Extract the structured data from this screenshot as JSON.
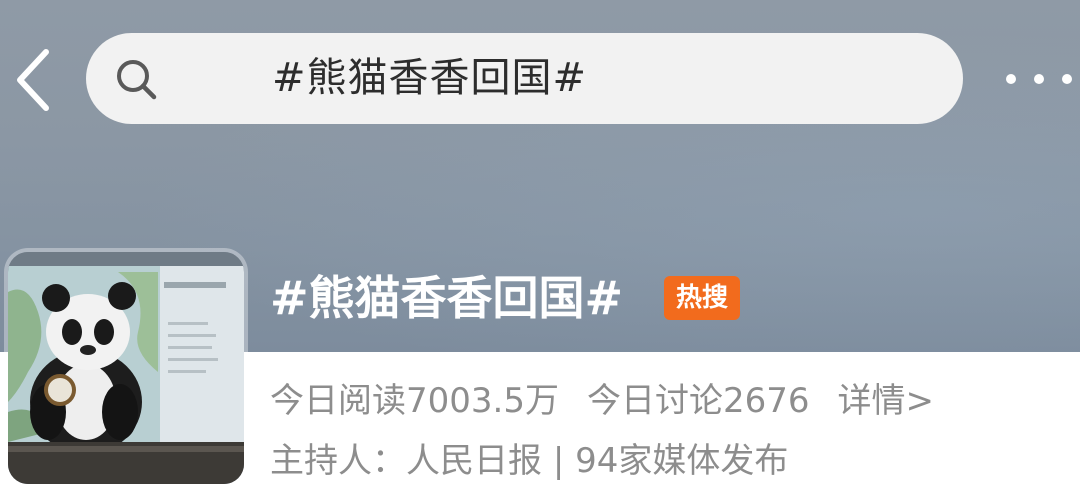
{
  "header": {
    "search": {
      "query": "#熊猫香香回国#"
    },
    "icons": {
      "back": "chevron-left-icon",
      "search": "search-icon",
      "more": "more-horizontal-icon"
    }
  },
  "topic": {
    "title": "#熊猫香香回国#",
    "badge": "热搜",
    "thumbnail_icon": "panda-photo",
    "stats": {
      "reads": "今日阅读7003.5万",
      "discussions": "今日讨论2676",
      "details_link": "详情>"
    },
    "host": {
      "host_label": "主持人：人民日报",
      "separator": "|",
      "media_count": "94家媒体发布"
    }
  },
  "colors": {
    "hero_background": "#8b97a4",
    "badge": "#f26b1d",
    "secondary_text": "#8d8d8d",
    "search_bar": "#f2f2f2"
  }
}
